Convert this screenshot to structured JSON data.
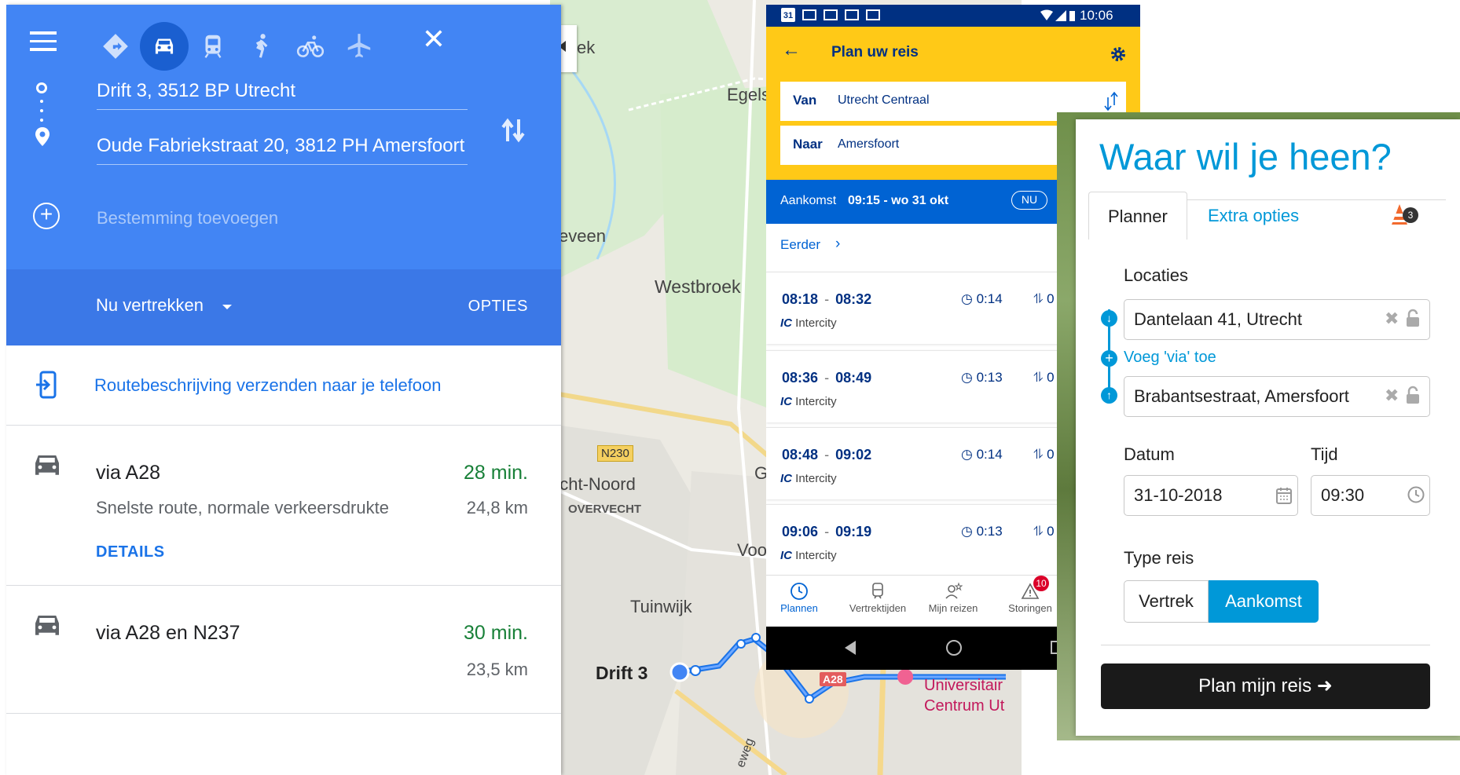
{
  "colors": {
    "gm_blue": "#4285f4",
    "gm_blue_dark": "#3b78e7",
    "gm_green": "#188038",
    "ns_yellow": "#ffc917",
    "ns_blue": "#003082",
    "ns_arr_blue": "#0063d3",
    "pl_blue": "#0098d8"
  },
  "google_maps": {
    "modes": [
      "route-icon",
      "car-icon",
      "train-icon",
      "walk-icon",
      "bike-icon",
      "plane-icon"
    ],
    "origin": "Drift 3, 3512 BP Utrecht",
    "destination": "Oude Fabriekstraat 20, 3812 PH Amersfoort",
    "add_destination": "Bestemming toevoegen",
    "depart_label": "Nu vertrekken",
    "options_label": "OPTIES",
    "send_to_phone": "Routebeschrijving verzenden naar je telefoon",
    "routes": [
      {
        "name": "via A28",
        "time": "28 min.",
        "sub": "Snelste route, normale verkeersdrukte",
        "distance": "24,8 km",
        "details": "DETAILS"
      },
      {
        "name": "via A28 en N237",
        "time": "30 min.",
        "distance": "23,5 km"
      }
    ]
  },
  "map": {
    "labels": {
      "ek": "ek",
      "egels": "Egels",
      "seveen": "seveen",
      "westbroek": "Westbroek",
      "n230": "N230",
      "noord": "echt-Noord",
      "overvecht": "OVERVECHT",
      "g": "G",
      "voo": "Voo",
      "tuinwijk": "Tuinwijk",
      "drift": "Drift 3",
      "a28": "A28",
      "univ": "Universitair",
      "centrum": "Centrum Ut",
      "weg": "eweg"
    }
  },
  "ns_app": {
    "status_time": "10:06",
    "status_date_icon": "31",
    "title": "Plan uw reis",
    "van_label": "Van",
    "van_value": "Utrecht Centraal",
    "naar_label": "Naar",
    "naar_value": "Amersfoort",
    "arrival_label": "Aankomst",
    "arrival_value": "09:15 - wo 31 okt",
    "nu_label": "NU",
    "earlier": "Eerder",
    "trips": [
      {
        "dep": "08:18",
        "arr": "08:32",
        "duration": "0:14",
        "transfers": "0",
        "type_code": "IC",
        "type": "Intercity"
      },
      {
        "dep": "08:36",
        "arr": "08:49",
        "duration": "0:13",
        "transfers": "0",
        "type_code": "IC",
        "type": "Intercity"
      },
      {
        "dep": "08:48",
        "arr": "09:02",
        "duration": "0:14",
        "transfers": "0",
        "type_code": "IC",
        "type": "Intercity"
      },
      {
        "dep": "09:06",
        "arr": "09:19",
        "duration": "0:13",
        "transfers": "0",
        "type_code": "IC",
        "type": "Intercity"
      }
    ],
    "tabs": [
      "Plannen",
      "Vertrektijden",
      "Mijn reizen",
      "Storingen"
    ],
    "storingen_badge": "10"
  },
  "planner": {
    "title": "Waar wil je heen?",
    "tabs": [
      "Planner",
      "Extra opties"
    ],
    "alert_badge": "3",
    "locations_label": "Locaties",
    "from_value": "Dantelaan 41, Utrecht",
    "via_label": "Voeg 'via' toe",
    "to_value": "Brabantsestraat, Amersfoort",
    "date_label": "Datum",
    "date_value": "31-10-2018",
    "time_label": "Tijd",
    "time_value": "09:30",
    "type_label": "Type reis",
    "type_options": [
      "Vertrek",
      "Aankomst"
    ],
    "type_selected": "Aankomst",
    "submit_label": "Plan mijn reis"
  }
}
